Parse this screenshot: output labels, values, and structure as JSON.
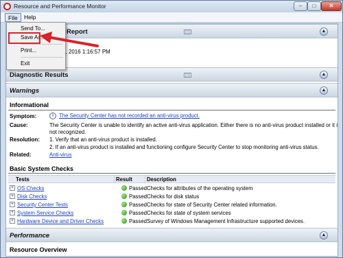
{
  "window": {
    "title": "Resource and Performance Monitor",
    "controls": {
      "minimize": "–",
      "maximize": "□",
      "close": "✕"
    }
  },
  "menubar": {
    "items": [
      "File",
      "Help"
    ]
  },
  "file_menu": {
    "items": [
      "Send To...",
      "Save As...",
      "Print...",
      "Exit"
    ],
    "highlighted": "Save As..."
  },
  "report": {
    "title": "Report",
    "date_fragment": "9, 2016 1:16:57 PM"
  },
  "sections": {
    "diagnostic_results": "Diagnostic Results",
    "warnings": "Warnings",
    "performance": "Performance",
    "resource_overview": "Resource Overview"
  },
  "informational": {
    "title": "Informational",
    "symptom_label": "Symptom:",
    "symptom": "The Security Center has not recorded an anti-virus product.",
    "cause_label": "Cause:",
    "cause_line1": "The Security Center is unable to identify an active anti-virus application. Either there is no anti-virus product installed or it is",
    "cause_line2": "not recognized.",
    "resolution_label": "Resolution:",
    "resolution_1": "1. Verify that an anti-virus product is installed.",
    "resolution_2": "2. If an anti-virus product is installed and functioning configure Security Center to stop monitoring anti-virus status.",
    "related_label": "Related:",
    "related_link": "Anti-virus"
  },
  "basic_checks": {
    "title": "Basic System Checks",
    "columns": [
      "Tests",
      "Result",
      "Description"
    ],
    "rows": [
      {
        "test": "OS Checks",
        "result": "Passed",
        "description": "Checks for attributes of the operating system"
      },
      {
        "test": "Disk Checks",
        "result": "Passed",
        "description": "Checks for disk status"
      },
      {
        "test": "Security Center Tests",
        "result": "Passed",
        "description": "Checks for state of Security Center related information."
      },
      {
        "test": "System Service Checks",
        "result": "Passed",
        "description": "Checks for state of system services"
      },
      {
        "test": "Hardware Device and Driver Checks",
        "result": "Passed",
        "description": "Survey of Windows Management Infrastructure supported devices."
      }
    ]
  },
  "icons": {
    "collapse": "collapse-icon",
    "expander": "plus-expander-icon",
    "ok": "green-check-icon",
    "warning": "info-icon"
  },
  "colors": {
    "highlight": "#d8232a",
    "link": "#1a3fbf",
    "ok": "#2d8a1a"
  }
}
